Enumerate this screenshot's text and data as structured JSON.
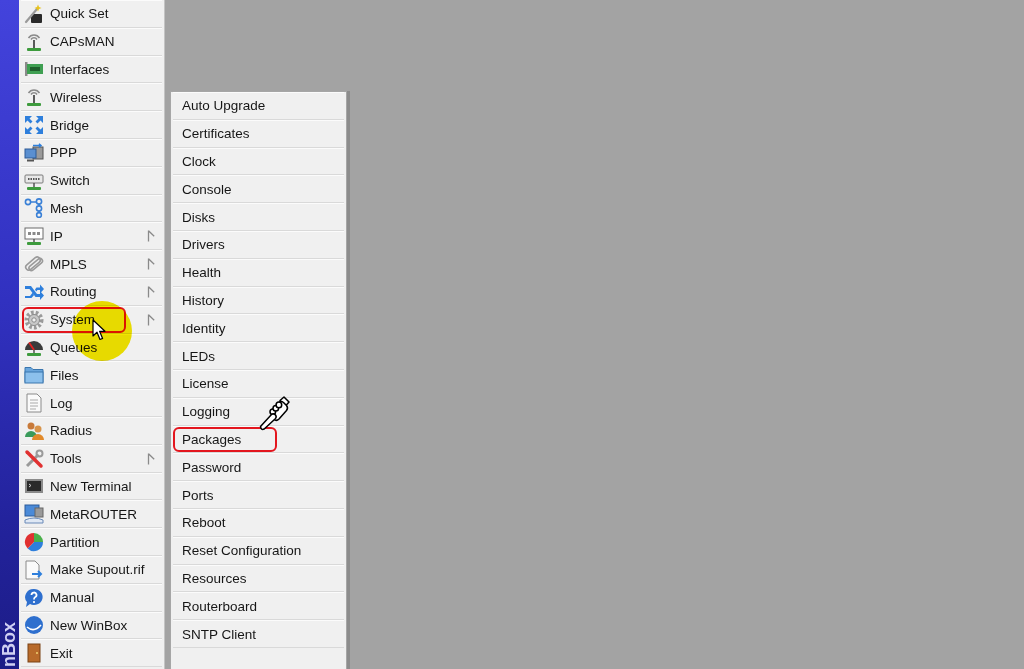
{
  "brand_strip": {
    "text": "nBox"
  },
  "main_menu": {
    "items": [
      {
        "label": "Quick Set",
        "has_submenu": false,
        "highlighted": false
      },
      {
        "label": "CAPsMAN",
        "has_submenu": false,
        "highlighted": false
      },
      {
        "label": "Interfaces",
        "has_submenu": false,
        "highlighted": false
      },
      {
        "label": "Wireless",
        "has_submenu": false,
        "highlighted": false
      },
      {
        "label": "Bridge",
        "has_submenu": false,
        "highlighted": false
      },
      {
        "label": "PPP",
        "has_submenu": false,
        "highlighted": false
      },
      {
        "label": "Switch",
        "has_submenu": false,
        "highlighted": false
      },
      {
        "label": "Mesh",
        "has_submenu": false,
        "highlighted": false
      },
      {
        "label": "IP",
        "has_submenu": true,
        "highlighted": false
      },
      {
        "label": "MPLS",
        "has_submenu": true,
        "highlighted": false
      },
      {
        "label": "Routing",
        "has_submenu": true,
        "highlighted": false
      },
      {
        "label": "System",
        "has_submenu": true,
        "highlighted": true,
        "click_highlight": true,
        "cursor": {
          "kind": "arrow"
        }
      },
      {
        "label": "Queues",
        "has_submenu": false,
        "highlighted": false
      },
      {
        "label": "Files",
        "has_submenu": false,
        "highlighted": false
      },
      {
        "label": "Log",
        "has_submenu": false,
        "highlighted": false
      },
      {
        "label": "Radius",
        "has_submenu": false,
        "highlighted": false
      },
      {
        "label": "Tools",
        "has_submenu": true,
        "highlighted": false
      },
      {
        "label": "New Terminal",
        "has_submenu": false,
        "highlighted": false
      },
      {
        "label": "MetaROUTER",
        "has_submenu": false,
        "highlighted": false
      },
      {
        "label": "Partition",
        "has_submenu": false,
        "highlighted": false
      },
      {
        "label": "Make Supout.rif",
        "has_submenu": false,
        "highlighted": false
      },
      {
        "label": "Manual",
        "has_submenu": false,
        "highlighted": false
      },
      {
        "label": "New WinBox",
        "has_submenu": false,
        "highlighted": false
      },
      {
        "label": "Exit",
        "has_submenu": false,
        "highlighted": false
      }
    ]
  },
  "submenu": {
    "items": [
      {
        "label": "Auto Upgrade",
        "highlighted": false
      },
      {
        "label": "Certificates",
        "highlighted": false
      },
      {
        "label": "Clock",
        "highlighted": false
      },
      {
        "label": "Console",
        "highlighted": false
      },
      {
        "label": "Disks",
        "highlighted": false
      },
      {
        "label": "Drivers",
        "highlighted": false
      },
      {
        "label": "Health",
        "highlighted": false
      },
      {
        "label": "History",
        "highlighted": false
      },
      {
        "label": "Identity",
        "highlighted": false
      },
      {
        "label": "LEDs",
        "highlighted": false
      },
      {
        "label": "License",
        "highlighted": false
      },
      {
        "label": "Logging",
        "highlighted": false
      },
      {
        "label": "Packages",
        "highlighted": true,
        "cursor": {
          "kind": "hand"
        }
      },
      {
        "label": "Password",
        "highlighted": false
      },
      {
        "label": "Ports",
        "highlighted": false
      },
      {
        "label": "Reboot",
        "highlighted": false
      },
      {
        "label": "Reset Configuration",
        "highlighted": false
      },
      {
        "label": "Resources",
        "highlighted": false
      },
      {
        "label": "Routerboard",
        "highlighted": false
      },
      {
        "label": "SNTP Client",
        "highlighted": false
      }
    ]
  }
}
